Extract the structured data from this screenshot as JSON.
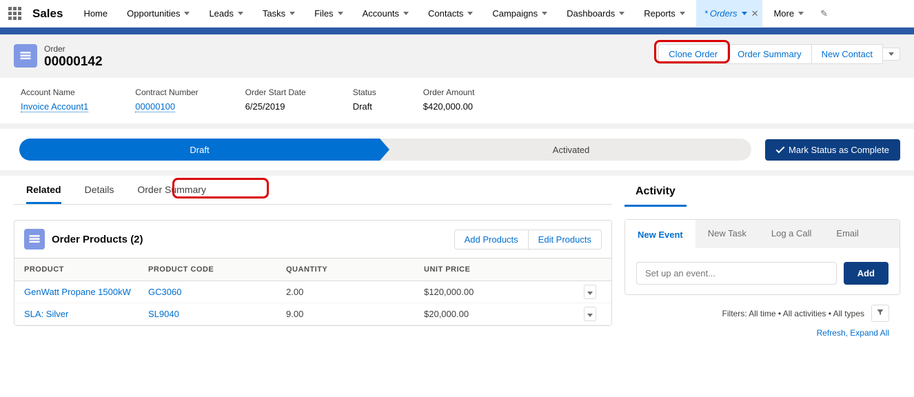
{
  "nav": {
    "app": "Sales",
    "items": [
      "Home",
      "Opportunities",
      "Leads",
      "Tasks",
      "Files",
      "Accounts",
      "Contacts",
      "Campaigns",
      "Dashboards",
      "Reports"
    ],
    "orders": "Orders",
    "more": "More"
  },
  "header": {
    "object_label": "Order",
    "record_number": "00000142",
    "actions": {
      "clone": "Clone Order",
      "summary": "Order Summary",
      "new_contact": "New Contact"
    }
  },
  "fields": {
    "account": {
      "label": "Account Name",
      "value": "Invoice Account1"
    },
    "contract": {
      "label": "Contract Number",
      "value": "00000100"
    },
    "start": {
      "label": "Order Start Date",
      "value": "6/25/2019"
    },
    "status": {
      "label": "Status",
      "value": "Draft"
    },
    "amount": {
      "label": "Order Amount",
      "value": "$420,000.00"
    }
  },
  "path": {
    "draft": "Draft",
    "activated": "Activated",
    "mark": "Mark Status as Complete"
  },
  "tabs": {
    "related": "Related",
    "details": "Details",
    "order_summary": "Order Summary"
  },
  "products_card": {
    "title": "Order Products (2)",
    "add": "Add Products",
    "edit": "Edit Products",
    "cols": {
      "product": "PRODUCT",
      "code": "PRODUCT CODE",
      "qty": "QUANTITY",
      "price": "UNIT PRICE"
    },
    "rows": [
      {
        "product": "GenWatt Propane 1500kW",
        "code": "GC3060",
        "qty": "2.00",
        "price": "$120,000.00"
      },
      {
        "product": "SLA: Silver",
        "code": "SL9040",
        "qty": "9.00",
        "price": "$20,000.00"
      }
    ]
  },
  "activity": {
    "title": "Activity",
    "tabs": {
      "new_event": "New Event",
      "new_task": "New Task",
      "log_call": "Log a Call",
      "email": "Email"
    },
    "placeholder": "Set up an event...",
    "add": "Add",
    "filters": "Filters: All time • All activities • All types",
    "refresh": "Refresh, Expand All"
  }
}
